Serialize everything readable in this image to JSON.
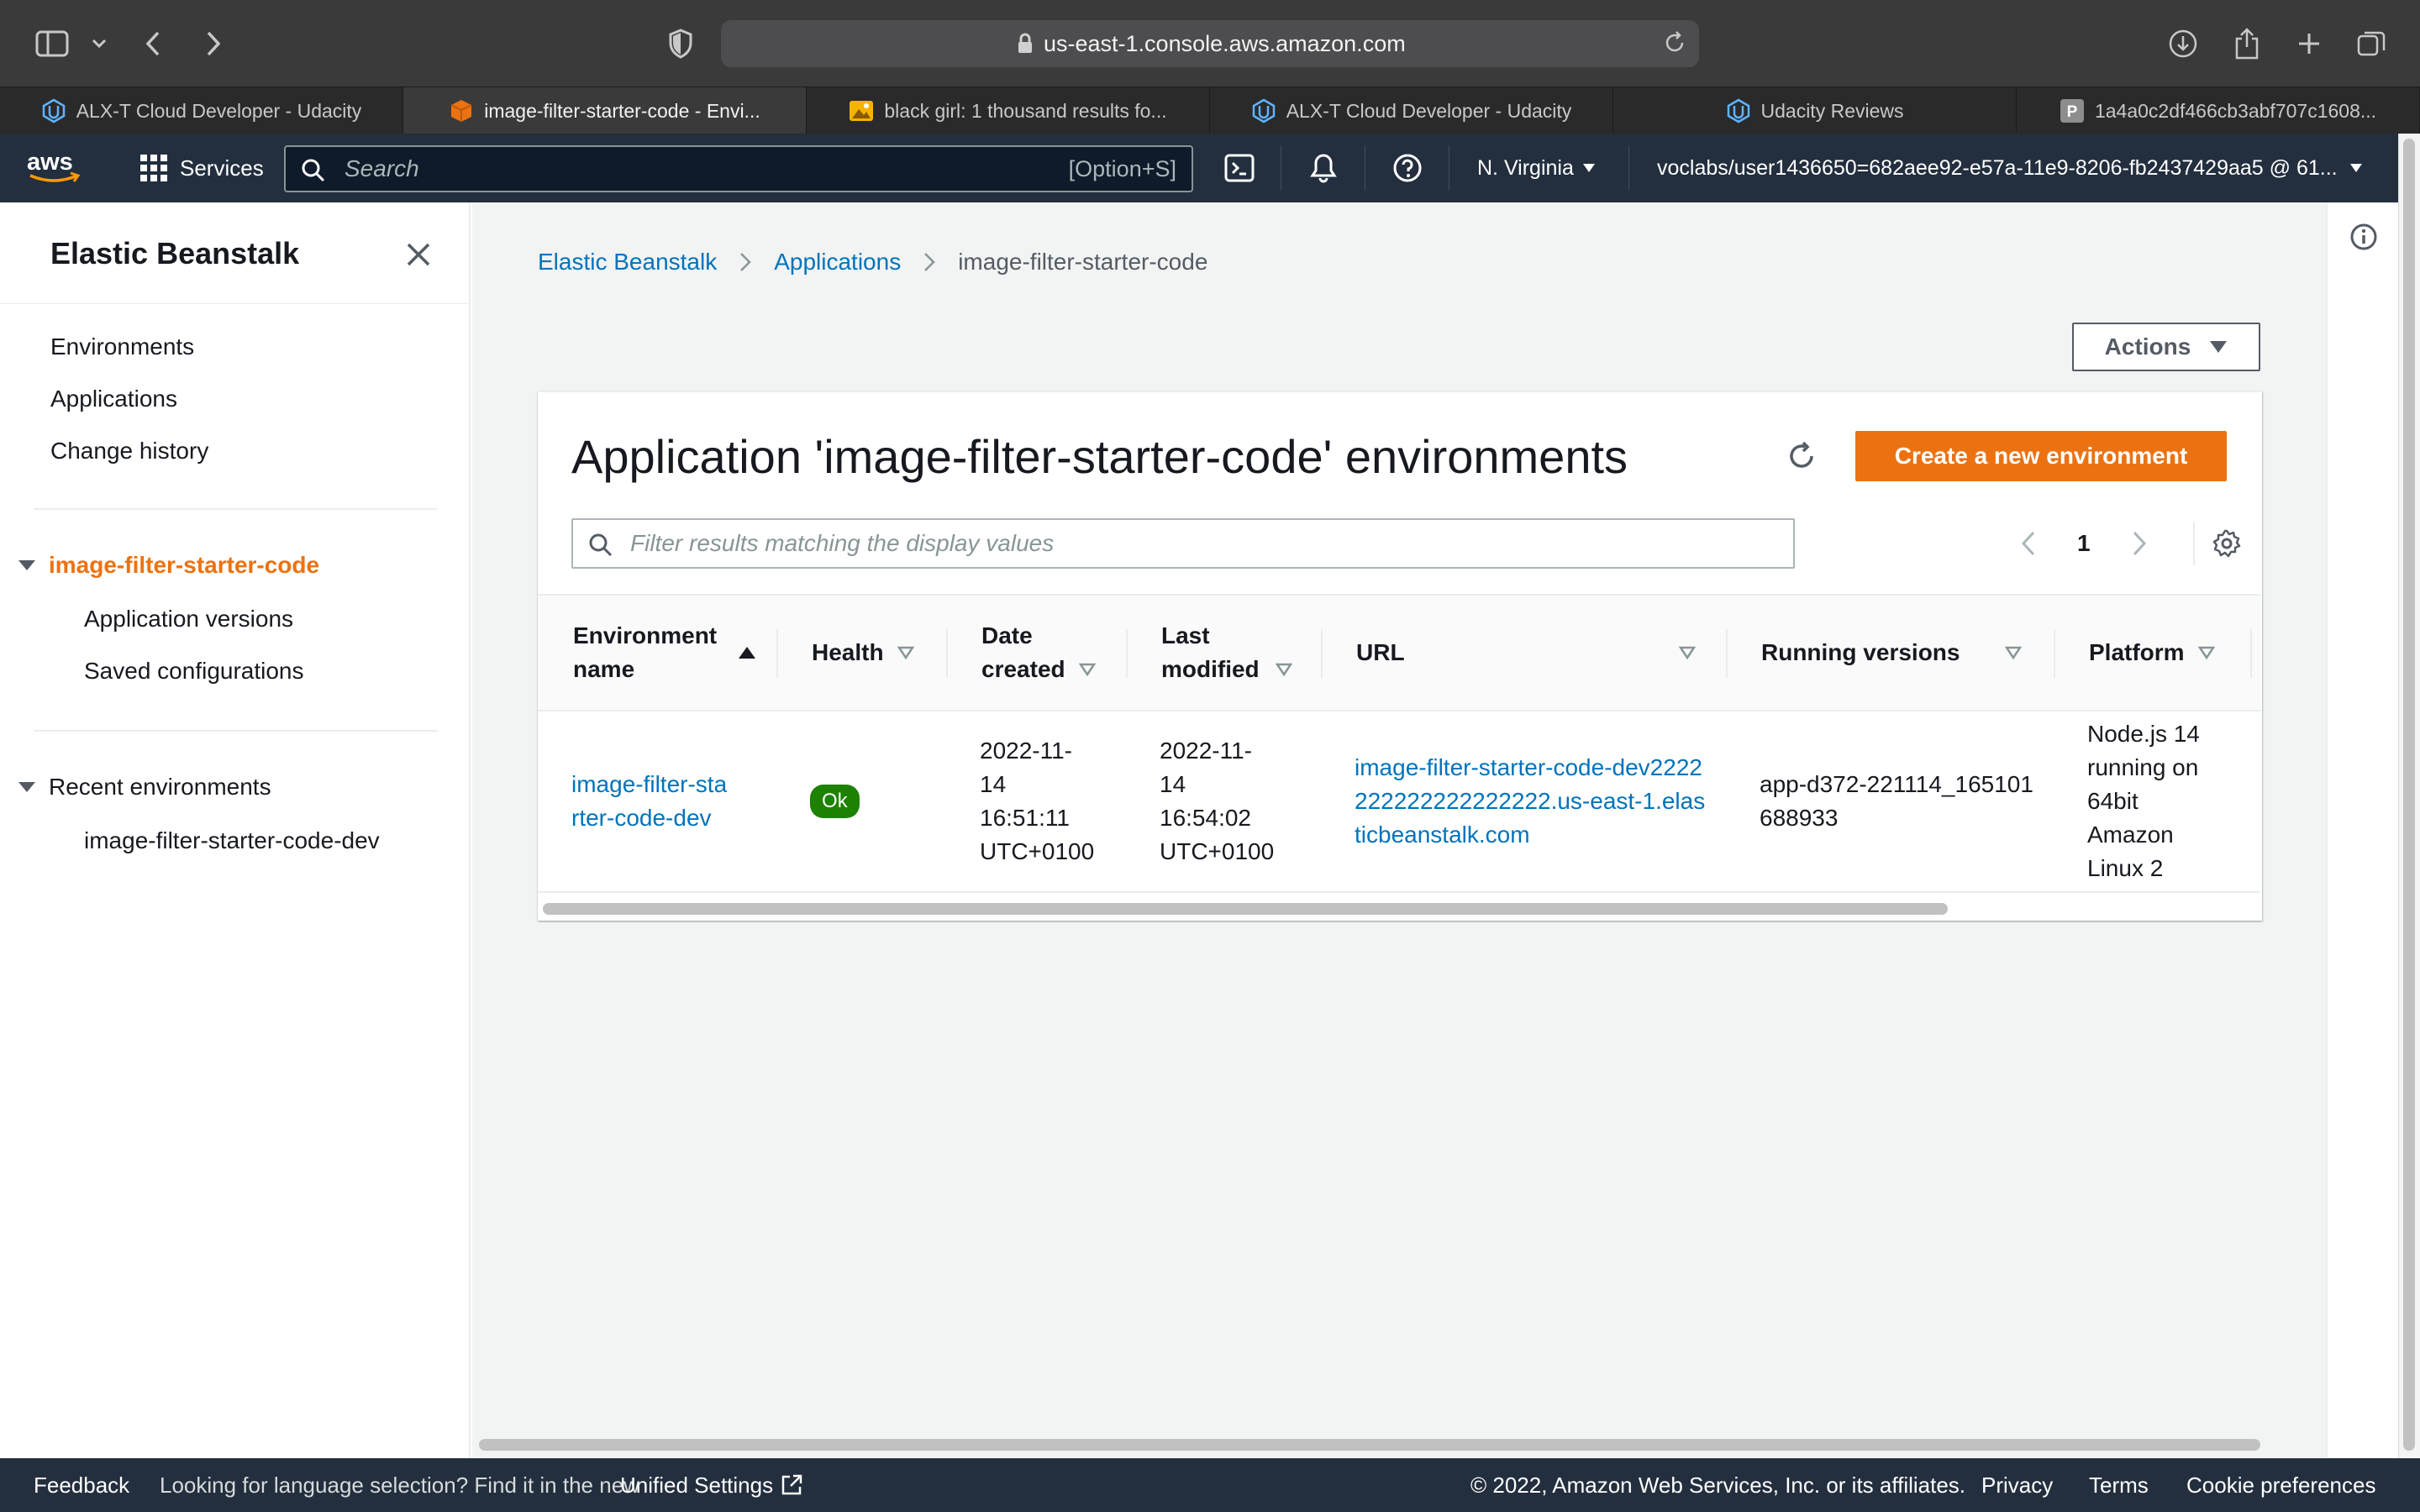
{
  "browser": {
    "url": "us-east-1.console.aws.amazon.com",
    "tabs": [
      {
        "label": "ALX-T Cloud Developer - Udacity",
        "icon": "udacity-icon",
        "active": false
      },
      {
        "label": "image-filter-starter-code - Envi...",
        "icon": "aws-cube-icon",
        "active": true
      },
      {
        "label": "black girl: 1 thousand results fo...",
        "icon": "image-search-icon",
        "active": false
      },
      {
        "label": "ALX-T Cloud Developer - Udacity",
        "icon": "udacity-icon",
        "active": false
      },
      {
        "label": "Udacity Reviews",
        "icon": "udacity-icon",
        "active": false
      },
      {
        "label": "1a4a0c2df466cb3abf707c1608...",
        "icon": "p-letter-icon",
        "active": false
      }
    ]
  },
  "aws_nav": {
    "services_label": "Services",
    "search_placeholder": "Search",
    "search_shortcut": "[Option+S]",
    "region": "N. Virginia",
    "account": "voclabs/user1436650=682aee92-e57a-11e9-8206-fb2437429aa5 @ 61..."
  },
  "sidebar": {
    "title": "Elastic Beanstalk",
    "links": [
      "Environments",
      "Applications",
      "Change history"
    ],
    "app_group": {
      "label": "image-filter-starter-code",
      "items": [
        "Application versions",
        "Saved configurations"
      ]
    },
    "recent_group": {
      "label": "Recent environments",
      "items": [
        "image-filter-starter-code-dev"
      ]
    }
  },
  "breadcrumb": {
    "items": [
      "Elastic Beanstalk",
      "Applications",
      "image-filter-starter-code"
    ]
  },
  "actions_label": "Actions",
  "panel": {
    "title": "Application 'image-filter-starter-code' environments",
    "create_label": "Create a new environment",
    "filter_placeholder": "Filter results matching the display values",
    "page_number": "1",
    "columns": [
      "Environment name",
      "Health",
      "Date created",
      "Last modified",
      "URL",
      "Running versions",
      "Platform"
    ],
    "rows": [
      {
        "name": "image-filter-starter-code-dev",
        "health": "Ok",
        "date_created": "2022-11-14 16:51:11 UTC+0100",
        "last_modified": "2022-11-14 16:54:02 UTC+0100",
        "url": "image-filter-starter-code-dev2222222222222222222.us-east-1.elasticbeanstalk.com",
        "running_version": "app-d372-221114_165101688933",
        "platform": "Node.js 14 running on 64bit Amazon Linux 2"
      }
    ]
  },
  "footer": {
    "feedback": "Feedback",
    "language_text": "Looking for language selection? Find it in the new",
    "unified_settings": "Unified Settings",
    "copyright": "© 2022, Amazon Web Services, Inc. or its affiliates.",
    "privacy": "Privacy",
    "terms": "Terms",
    "cookie": "Cookie preferences"
  },
  "colors": {
    "aws_nav": "#232f3e",
    "accent_orange": "#ec7211",
    "link_blue": "#0073bb",
    "ok_green": "#1d8102"
  }
}
